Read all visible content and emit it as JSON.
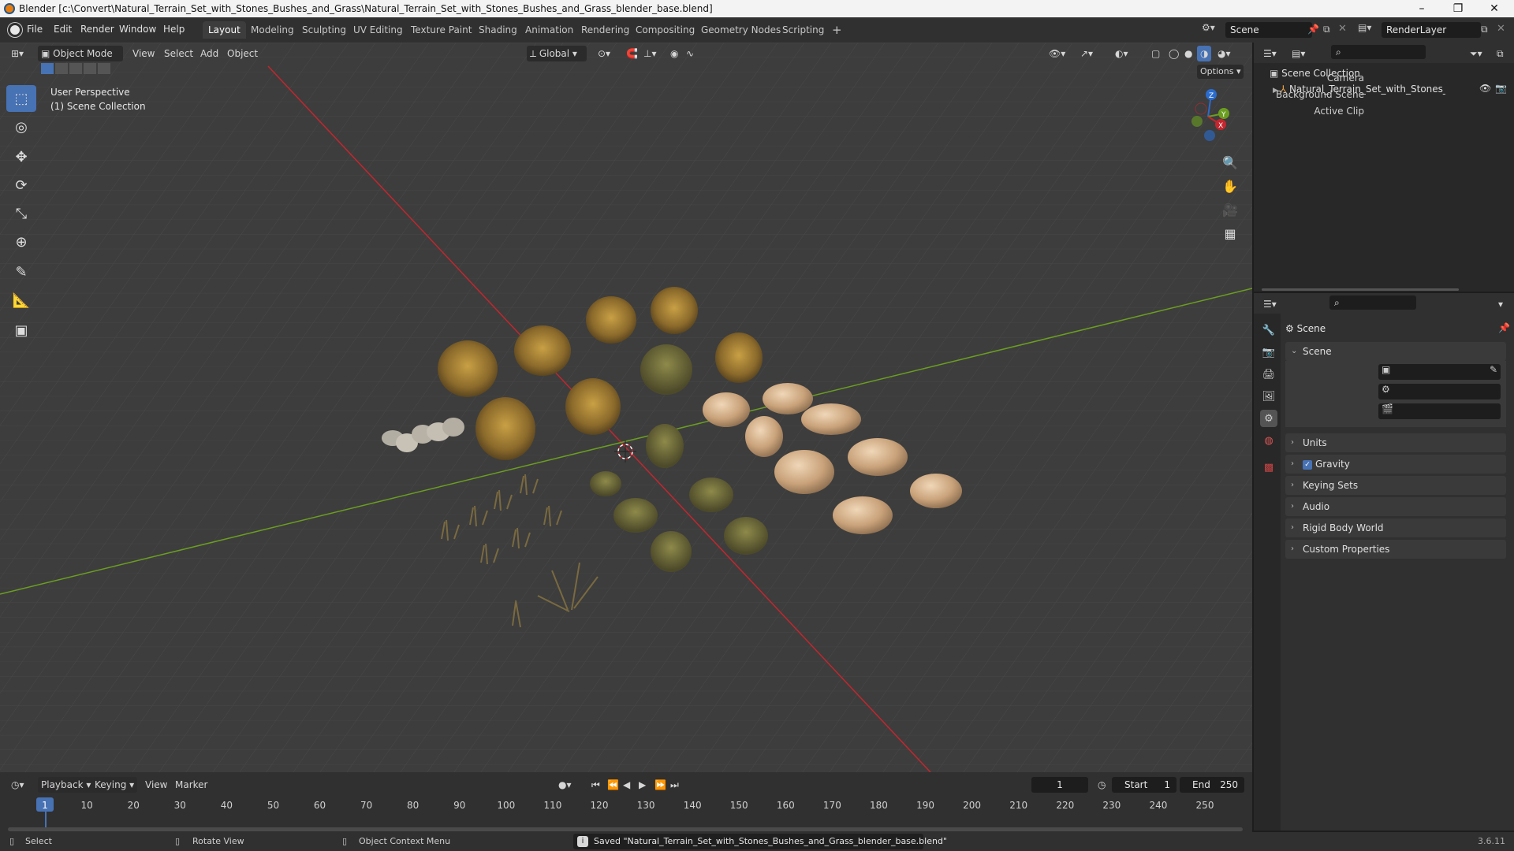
{
  "window": {
    "title": "Blender [c:\\Convert\\Natural_Terrain_Set_with_Stones_Bushes_and_Grass\\Natural_Terrain_Set_with_Stones_Bushes_and_Grass_blender_base.blend]",
    "minimize": "–",
    "maximize": "❐",
    "close": "✕"
  },
  "menu": {
    "file": "File",
    "edit": "Edit",
    "render": "Render",
    "window": "Window",
    "help": "Help"
  },
  "workspaces": [
    "Layout",
    "Modeling",
    "Sculpting",
    "UV Editing",
    "Texture Paint",
    "Shading",
    "Animation",
    "Rendering",
    "Compositing",
    "Geometry Nodes",
    "Scripting"
  ],
  "workspace_add": "+",
  "scene_selector": "Scene",
  "view_layer": "RenderLayer",
  "viewport": {
    "mode": "Object Mode",
    "view": "View",
    "select": "Select",
    "add": "Add",
    "object": "Object",
    "orientation": "Global",
    "options": "Options",
    "perspective_label": "User Perspective",
    "collection_label": "(1) Scene Collection",
    "axes": {
      "x": "X",
      "y": "Y",
      "z": "Z"
    }
  },
  "outliner": {
    "root": "Scene Collection",
    "item": "Natural_Terrain_Set_with_Stones_Bushes_and_Grass"
  },
  "properties": {
    "context": "Scene",
    "panel": "Scene",
    "camera_label": "Camera",
    "background_scene_label": "Background Scene",
    "active_clip_label": "Active Clip",
    "subpanels": [
      "Units",
      "Gravity",
      "Keying Sets",
      "Audio",
      "Rigid Body World",
      "Custom Properties"
    ],
    "gravity_checked": true
  },
  "timeline": {
    "playback": "Playback",
    "keying": "Keying",
    "view": "View",
    "marker": "Marker",
    "current_frame": "1",
    "start_label": "Start",
    "start": "1",
    "end_label": "End",
    "end": "250",
    "ticks": [
      "1",
      "10",
      "20",
      "30",
      "40",
      "50",
      "60",
      "70",
      "80",
      "90",
      "100",
      "110",
      "120",
      "130",
      "140",
      "150",
      "160",
      "170",
      "180",
      "190",
      "200",
      "210",
      "220",
      "230",
      "240",
      "250"
    ]
  },
  "status": {
    "select": "Select",
    "rotate": "Rotate View",
    "context_menu": "Object Context Menu",
    "message": "Saved \"Natural_Terrain_Set_with_Stones_Bushes_and_Grass_blender_base.blend\"",
    "version": "3.6.11"
  },
  "colors": {
    "accent": "#4772b3",
    "x_axis": "#c4262e",
    "y_axis": "#6b9e20",
    "z_axis": "#2a6cce",
    "bg": "#3d3d3d"
  }
}
